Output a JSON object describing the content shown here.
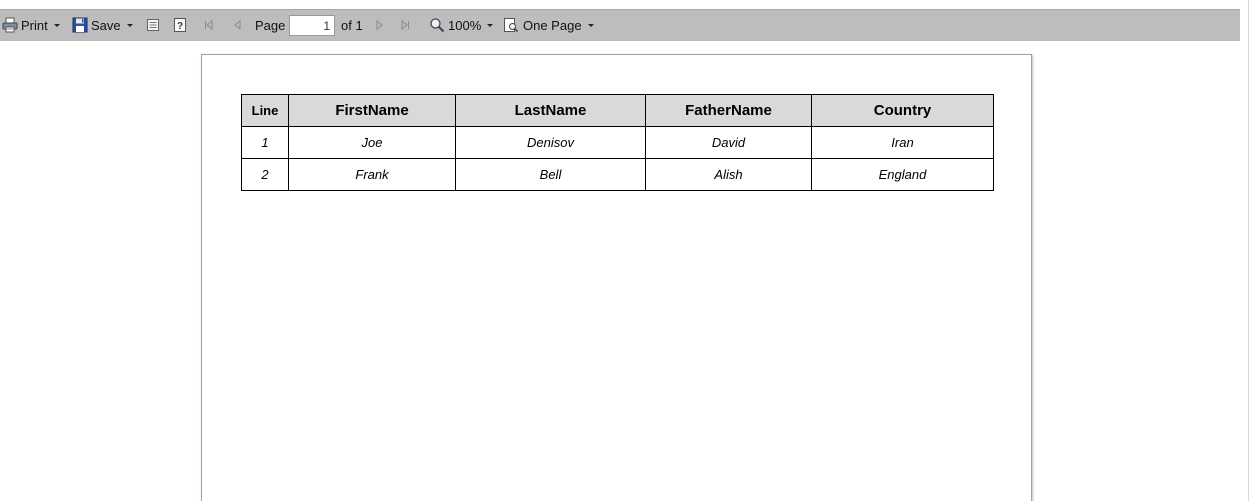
{
  "toolbar": {
    "print_label": "Print",
    "save_label": "Save",
    "page_label": "Page",
    "page_value": "1",
    "of_label": "of 1",
    "zoom_label": "100%",
    "view_label": "One Page"
  },
  "report": {
    "columns": [
      "Line",
      "FirstName",
      "LastName",
      "FatherName",
      "Country"
    ],
    "rows": [
      [
        "1",
        "Joe",
        "Denisov",
        "David",
        "Iran"
      ],
      [
        "2",
        "Frank",
        "Bell",
        "Alish",
        "England"
      ]
    ]
  }
}
